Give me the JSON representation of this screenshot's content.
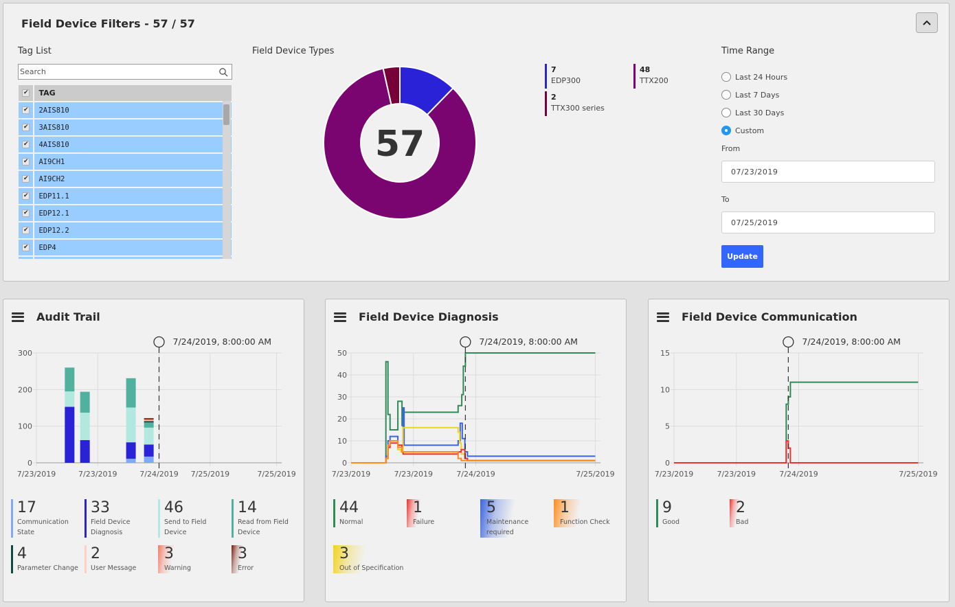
{
  "filters": {
    "title": "Field Device Filters - 57 / 57",
    "collapse_icon": "chevron-up-icon",
    "tag_list": {
      "label": "Tag List",
      "search_placeholder": "Search",
      "column_header": "TAG",
      "rows": [
        "2AIS810",
        "3AIS810",
        "4AIS810",
        "AI9CH1",
        "AI9CH2",
        "EDP11.1",
        "EDP12.1",
        "EDP12.2",
        "EDP4"
      ]
    },
    "device_types": {
      "label": "Field Device Types",
      "total": "57",
      "legend": [
        {
          "value": "7",
          "name": "EDP300",
          "color": "#2a22d6"
        },
        {
          "value": "48",
          "name": "TTX200",
          "color": "#7a0571"
        },
        {
          "value": "2",
          "name": "TTX300 series",
          "color": "#770038"
        }
      ]
    },
    "time_range": {
      "label": "Time Range",
      "options": [
        "Last 24 Hours",
        "Last 7 Days",
        "Last 30 Days",
        "Custom"
      ],
      "selected": "Custom",
      "from_label": "From",
      "from_value": "07/23/2019",
      "to_label": "To",
      "to_value": "07/25/2019",
      "update_label": "Update"
    }
  },
  "cards": {
    "audit": {
      "title": "Audit Trail",
      "marker_label": "7/24/2019, 8:00:00 AM",
      "stats": [
        {
          "value": "17",
          "label": "Communication State",
          "color": "#7ea8f8"
        },
        {
          "value": "33",
          "label": "Field Device Diagnosis",
          "color": "#2a22d6"
        },
        {
          "value": "46",
          "label": "Send to Field Device",
          "color": "#b3e8de"
        },
        {
          "value": "14",
          "label": "Read from Field Device",
          "color": "#4fb19e"
        },
        {
          "value": "4",
          "label": "Parameter Change",
          "color": "#0b4a3c"
        },
        {
          "value": "2",
          "label": "User Message",
          "color": "#ffcfc4"
        },
        {
          "value": "3",
          "label": "Warning",
          "color": "#f47a63"
        },
        {
          "value": "3",
          "label": "Error",
          "color": "#7a1a0a"
        }
      ]
    },
    "diag": {
      "title": "Field Device Diagnosis",
      "marker_label": "7/24/2019, 8:00:00 AM",
      "stats": [
        {
          "value": "44",
          "label": "Normal",
          "color": "#2e8b57"
        },
        {
          "value": "1",
          "label": "Failure",
          "color": "#f0302a"
        },
        {
          "value": "5",
          "label": "Maintenance required",
          "color": "#3b65e0"
        },
        {
          "value": "1",
          "label": "Function Check",
          "color": "#ff8c1a"
        },
        {
          "value": "3",
          "label": "Out of Specification",
          "color": "#f2d31b"
        }
      ]
    },
    "comm": {
      "title": "Field Device Communication",
      "marker_label": "7/24/2019, 8:00:00 AM",
      "stats": [
        {
          "value": "9",
          "label": "Good",
          "color": "#2e8b57"
        },
        {
          "value": "2",
          "label": "Bad",
          "color": "#f0302a"
        }
      ]
    }
  },
  "chart_data": [
    {
      "type": "pie",
      "title": "Field Device Types",
      "center_label": "57",
      "categories": [
        "EDP300",
        "TTX200",
        "TTX300 series"
      ],
      "values": [
        7,
        48,
        2
      ],
      "colors": [
        "#2a22d6",
        "#7a0571",
        "#770038"
      ]
    },
    {
      "type": "bar",
      "title": "Audit Trail",
      "stacked": true,
      "ylim": [
        0,
        300
      ],
      "yticks": [
        0,
        100,
        200,
        300
      ],
      "xlim_hours": [
        0,
        48
      ],
      "xticks": [
        {
          "h": 0,
          "label": "7/23/2019"
        },
        {
          "h": 12,
          "label": "7/23/2019"
        },
        {
          "h": 24,
          "label": "7/24/2019"
        },
        {
          "h": 34,
          "label": "7/25/2019"
        },
        {
          "h": 47,
          "label": "7/25/2019"
        }
      ],
      "marker_hour": 24,
      "bar_x_hours": [
        6.5,
        9.5,
        18.5,
        22
      ],
      "series": [
        {
          "name": "Communication State",
          "color": "#7ea8f8",
          "values": [
            0,
            0,
            11,
            17
          ]
        },
        {
          "name": "Field Device Diagnosis",
          "color": "#2a22d6",
          "values": [
            153,
            62,
            45,
            33
          ]
        },
        {
          "name": "Send to Field Device",
          "color": "#b3e8de",
          "values": [
            42,
            75,
            95,
            46
          ]
        },
        {
          "name": "Read from Field Device",
          "color": "#4fb19e",
          "values": [
            65,
            57,
            80,
            14
          ]
        },
        {
          "name": "Parameter Change",
          "color": "#0b4a3c",
          "values": [
            0,
            0,
            0,
            4
          ]
        },
        {
          "name": "User Message",
          "color": "#ffcfc4",
          "values": [
            0,
            0,
            0,
            2
          ]
        },
        {
          "name": "Warning",
          "color": "#f47a63",
          "values": [
            0,
            0,
            0,
            3
          ]
        },
        {
          "name": "Error",
          "color": "#7a1a0a",
          "values": [
            0,
            0,
            0,
            3
          ]
        }
      ]
    },
    {
      "type": "line",
      "title": "Field Device Diagnosis",
      "step": true,
      "ylim": [
        0,
        50
      ],
      "yticks": [
        0,
        10,
        20,
        30,
        40,
        50
      ],
      "xlim_hours": [
        0,
        48
      ],
      "xticks": [
        {
          "h": 0,
          "label": "7/23/2019"
        },
        {
          "h": 12,
          "label": "7/23/2019"
        },
        {
          "h": 24,
          "label": "7/24/2019"
        },
        {
          "h": 47,
          "label": "7/25/2019"
        }
      ],
      "marker_hour": 22,
      "series": [
        {
          "name": "Normal",
          "color": "#2e8b57",
          "points": [
            [
              0,
              0
            ],
            [
              6.7,
              0
            ],
            [
              6.7,
              46
            ],
            [
              7.1,
              46
            ],
            [
              7.1,
              22
            ],
            [
              7.5,
              22
            ],
            [
              7.5,
              15
            ],
            [
              9,
              15
            ],
            [
              9,
              28
            ],
            [
              9.8,
              28
            ],
            [
              9.8,
              17
            ],
            [
              10,
              17
            ],
            [
              10,
              23
            ],
            [
              20.6,
              23
            ],
            [
              20.6,
              26
            ],
            [
              21.3,
              26
            ],
            [
              21.3,
              31
            ],
            [
              21.6,
              31
            ],
            [
              21.6,
              44
            ],
            [
              22,
              44
            ],
            [
              22,
              50
            ],
            [
              47,
              50
            ]
          ]
        },
        {
          "name": "Maintenance required",
          "color": "#3b65e0",
          "points": [
            [
              0,
              0
            ],
            [
              6.7,
              0
            ],
            [
              6.7,
              3
            ],
            [
              7.1,
              3
            ],
            [
              7.1,
              10
            ],
            [
              7.5,
              10
            ],
            [
              7.5,
              12
            ],
            [
              9,
              12
            ],
            [
              9,
              8
            ],
            [
              10,
              8
            ],
            [
              10,
              25
            ],
            [
              10.2,
              25
            ],
            [
              10.2,
              8
            ],
            [
              20.6,
              8
            ],
            [
              20.6,
              10
            ],
            [
              21,
              10
            ],
            [
              21,
              18
            ],
            [
              21.4,
              18
            ],
            [
              21.4,
              11
            ],
            [
              21.9,
              11
            ],
            [
              21.9,
              5
            ],
            [
              22.4,
              5
            ],
            [
              22.4,
              3
            ],
            [
              47,
              3
            ]
          ]
        },
        {
          "name": "Out of Specification",
          "color": "#f2d31b",
          "points": [
            [
              0,
              0
            ],
            [
              6.7,
              0
            ],
            [
              6.7,
              2
            ],
            [
              7.1,
              2
            ],
            [
              7.1,
              8
            ],
            [
              7.5,
              8
            ],
            [
              7.5,
              10
            ],
            [
              9,
              10
            ],
            [
              9,
              6
            ],
            [
              9.6,
              6
            ],
            [
              9.6,
              5
            ],
            [
              10,
              5
            ],
            [
              10,
              16
            ],
            [
              20.6,
              16
            ],
            [
              20.6,
              14
            ],
            [
              20.9,
              14
            ],
            [
              20.9,
              9
            ],
            [
              21.2,
              9
            ],
            [
              21.2,
              4
            ],
            [
              21.9,
              4
            ],
            [
              21.9,
              2
            ],
            [
              22.4,
              2
            ],
            [
              22.4,
              1
            ],
            [
              47,
              1
            ]
          ]
        },
        {
          "name": "Failure",
          "color": "#f0302a",
          "points": [
            [
              0,
              0
            ],
            [
              6.7,
              0
            ],
            [
              6.7,
              2
            ],
            [
              7.1,
              2
            ],
            [
              7.1,
              7
            ],
            [
              7.5,
              7
            ],
            [
              7.5,
              9
            ],
            [
              9,
              9
            ],
            [
              9,
              8
            ],
            [
              9.8,
              8
            ],
            [
              9.8,
              5
            ],
            [
              10,
              5
            ],
            [
              10,
              4
            ],
            [
              20.6,
              4
            ],
            [
              20.6,
              5
            ],
            [
              21.2,
              5
            ],
            [
              21.2,
              6
            ],
            [
              21.9,
              6
            ],
            [
              21.9,
              2
            ],
            [
              22.4,
              2
            ],
            [
              22.4,
              1
            ],
            [
              47,
              1
            ]
          ]
        },
        {
          "name": "Function Check",
          "color": "#ff8c1a",
          "points": [
            [
              0,
              0
            ],
            [
              6.7,
              0
            ],
            [
              6.7,
              2
            ],
            [
              7.1,
              2
            ],
            [
              7.1,
              8
            ],
            [
              7.5,
              8
            ],
            [
              7.5,
              10
            ],
            [
              9,
              10
            ],
            [
              9,
              7
            ],
            [
              9.8,
              7
            ],
            [
              9.8,
              5
            ],
            [
              20.6,
              5
            ],
            [
              20.6,
              2
            ],
            [
              21.2,
              2
            ],
            [
              21.2,
              1
            ],
            [
              47,
              1
            ]
          ]
        }
      ]
    },
    {
      "type": "line",
      "title": "Field Device Communication",
      "step": true,
      "ylim": [
        0,
        15
      ],
      "yticks": [
        0,
        5,
        10,
        15
      ],
      "xlim_hours": [
        0,
        48
      ],
      "xticks": [
        {
          "h": 0,
          "label": "7/23/2019"
        },
        {
          "h": 12,
          "label": "7/23/2019"
        },
        {
          "h": 24,
          "label": "7/24/2019"
        },
        {
          "h": 47,
          "label": "7/25/2019"
        }
      ],
      "marker_hour": 22,
      "series": [
        {
          "name": "Good",
          "color": "#2e8b57",
          "points": [
            [
              0,
              0
            ],
            [
              21.6,
              0
            ],
            [
              21.6,
              8
            ],
            [
              22,
              8
            ],
            [
              22,
              9
            ],
            [
              22.4,
              9
            ],
            [
              22.4,
              11
            ],
            [
              47,
              11
            ]
          ]
        },
        {
          "name": "Bad",
          "color": "#f0302a",
          "points": [
            [
              0,
              0
            ],
            [
              21.6,
              0
            ],
            [
              21.6,
              3
            ],
            [
              22,
              3
            ],
            [
              22,
              2
            ],
            [
              22.4,
              2
            ],
            [
              22.4,
              0
            ],
            [
              47,
              0
            ]
          ]
        }
      ]
    }
  ]
}
